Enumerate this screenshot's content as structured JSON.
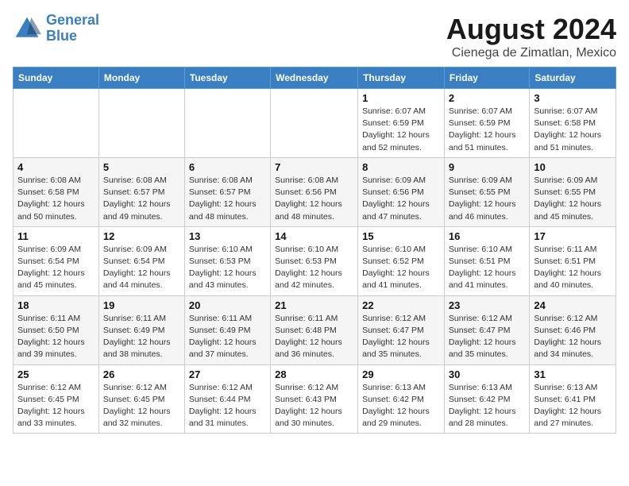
{
  "header": {
    "logo_line1": "General",
    "logo_line2": "Blue",
    "month": "August 2024",
    "location": "Cienega de Zimatlan, Mexico"
  },
  "days_of_week": [
    "Sunday",
    "Monday",
    "Tuesday",
    "Wednesday",
    "Thursday",
    "Friday",
    "Saturday"
  ],
  "weeks": [
    [
      {
        "day": "",
        "info": ""
      },
      {
        "day": "",
        "info": ""
      },
      {
        "day": "",
        "info": ""
      },
      {
        "day": "",
        "info": ""
      },
      {
        "day": "1",
        "info": "Sunrise: 6:07 AM\nSunset: 6:59 PM\nDaylight: 12 hours and 52 minutes."
      },
      {
        "day": "2",
        "info": "Sunrise: 6:07 AM\nSunset: 6:59 PM\nDaylight: 12 hours and 51 minutes."
      },
      {
        "day": "3",
        "info": "Sunrise: 6:07 AM\nSunset: 6:58 PM\nDaylight: 12 hours and 51 minutes."
      }
    ],
    [
      {
        "day": "4",
        "info": "Sunrise: 6:08 AM\nSunset: 6:58 PM\nDaylight: 12 hours and 50 minutes."
      },
      {
        "day": "5",
        "info": "Sunrise: 6:08 AM\nSunset: 6:57 PM\nDaylight: 12 hours and 49 minutes."
      },
      {
        "day": "6",
        "info": "Sunrise: 6:08 AM\nSunset: 6:57 PM\nDaylight: 12 hours and 48 minutes."
      },
      {
        "day": "7",
        "info": "Sunrise: 6:08 AM\nSunset: 6:56 PM\nDaylight: 12 hours and 48 minutes."
      },
      {
        "day": "8",
        "info": "Sunrise: 6:09 AM\nSunset: 6:56 PM\nDaylight: 12 hours and 47 minutes."
      },
      {
        "day": "9",
        "info": "Sunrise: 6:09 AM\nSunset: 6:55 PM\nDaylight: 12 hours and 46 minutes."
      },
      {
        "day": "10",
        "info": "Sunrise: 6:09 AM\nSunset: 6:55 PM\nDaylight: 12 hours and 45 minutes."
      }
    ],
    [
      {
        "day": "11",
        "info": "Sunrise: 6:09 AM\nSunset: 6:54 PM\nDaylight: 12 hours and 45 minutes."
      },
      {
        "day": "12",
        "info": "Sunrise: 6:09 AM\nSunset: 6:54 PM\nDaylight: 12 hours and 44 minutes."
      },
      {
        "day": "13",
        "info": "Sunrise: 6:10 AM\nSunset: 6:53 PM\nDaylight: 12 hours and 43 minutes."
      },
      {
        "day": "14",
        "info": "Sunrise: 6:10 AM\nSunset: 6:53 PM\nDaylight: 12 hours and 42 minutes."
      },
      {
        "day": "15",
        "info": "Sunrise: 6:10 AM\nSunset: 6:52 PM\nDaylight: 12 hours and 41 minutes."
      },
      {
        "day": "16",
        "info": "Sunrise: 6:10 AM\nSunset: 6:51 PM\nDaylight: 12 hours and 41 minutes."
      },
      {
        "day": "17",
        "info": "Sunrise: 6:11 AM\nSunset: 6:51 PM\nDaylight: 12 hours and 40 minutes."
      }
    ],
    [
      {
        "day": "18",
        "info": "Sunrise: 6:11 AM\nSunset: 6:50 PM\nDaylight: 12 hours and 39 minutes."
      },
      {
        "day": "19",
        "info": "Sunrise: 6:11 AM\nSunset: 6:49 PM\nDaylight: 12 hours and 38 minutes."
      },
      {
        "day": "20",
        "info": "Sunrise: 6:11 AM\nSunset: 6:49 PM\nDaylight: 12 hours and 37 minutes."
      },
      {
        "day": "21",
        "info": "Sunrise: 6:11 AM\nSunset: 6:48 PM\nDaylight: 12 hours and 36 minutes."
      },
      {
        "day": "22",
        "info": "Sunrise: 6:12 AM\nSunset: 6:47 PM\nDaylight: 12 hours and 35 minutes."
      },
      {
        "day": "23",
        "info": "Sunrise: 6:12 AM\nSunset: 6:47 PM\nDaylight: 12 hours and 35 minutes."
      },
      {
        "day": "24",
        "info": "Sunrise: 6:12 AM\nSunset: 6:46 PM\nDaylight: 12 hours and 34 minutes."
      }
    ],
    [
      {
        "day": "25",
        "info": "Sunrise: 6:12 AM\nSunset: 6:45 PM\nDaylight: 12 hours and 33 minutes."
      },
      {
        "day": "26",
        "info": "Sunrise: 6:12 AM\nSunset: 6:45 PM\nDaylight: 12 hours and 32 minutes."
      },
      {
        "day": "27",
        "info": "Sunrise: 6:12 AM\nSunset: 6:44 PM\nDaylight: 12 hours and 31 minutes."
      },
      {
        "day": "28",
        "info": "Sunrise: 6:12 AM\nSunset: 6:43 PM\nDaylight: 12 hours and 30 minutes."
      },
      {
        "day": "29",
        "info": "Sunrise: 6:13 AM\nSunset: 6:42 PM\nDaylight: 12 hours and 29 minutes."
      },
      {
        "day": "30",
        "info": "Sunrise: 6:13 AM\nSunset: 6:42 PM\nDaylight: 12 hours and 28 minutes."
      },
      {
        "day": "31",
        "info": "Sunrise: 6:13 AM\nSunset: 6:41 PM\nDaylight: 12 hours and 27 minutes."
      }
    ]
  ]
}
